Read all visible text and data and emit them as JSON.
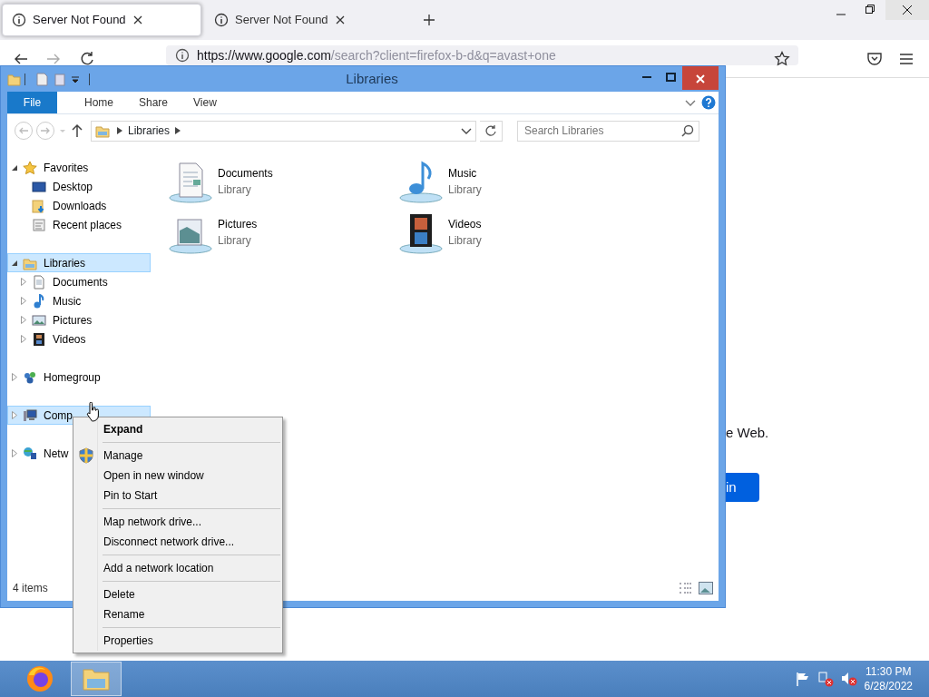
{
  "browser": {
    "tabs": [
      {
        "title": "Server Not Found",
        "selected": true
      },
      {
        "title": "Server Not Found",
        "selected": false
      }
    ],
    "url_host": "https://www.google.com",
    "url_path": "/search?client=firefox-b-d&q=avast+one",
    "page_text": "e Web.",
    "page_button": "in"
  },
  "explorer": {
    "title": "Libraries",
    "ribbon_tabs": [
      {
        "label": "File",
        "selected": true
      },
      {
        "label": "Home",
        "selected": false
      },
      {
        "label": "Share",
        "selected": false
      },
      {
        "label": "View",
        "selected": false
      }
    ],
    "breadcrumb": "Libraries",
    "search": {
      "placeholder": "Search Libraries"
    },
    "nav": [
      {
        "label": "Favorites",
        "kind": "star",
        "expanded": true,
        "selected": false,
        "children": [
          {
            "label": "Desktop",
            "kind": "desktop",
            "selected": false
          },
          {
            "label": "Downloads",
            "kind": "downloads",
            "selected": false
          },
          {
            "label": "Recent places",
            "kind": "recent",
            "selected": false
          }
        ]
      },
      {
        "label": "Libraries",
        "kind": "library",
        "expanded": true,
        "selected": true,
        "children": [
          {
            "label": "Documents",
            "kind": "documents",
            "expanded": false,
            "selected": false
          },
          {
            "label": "Music",
            "kind": "music",
            "expanded": false,
            "selected": false
          },
          {
            "label": "Pictures",
            "kind": "pictures",
            "expanded": false,
            "selected": false
          },
          {
            "label": "Videos",
            "kind": "videos",
            "expanded": false,
            "selected": false
          }
        ]
      },
      {
        "label": "Homegroup",
        "kind": "homegroup",
        "expanded": false,
        "selected": false
      },
      {
        "label": "Comp",
        "kind": "computer",
        "expanded": false,
        "selected": true
      },
      {
        "label": "Netw",
        "kind": "network",
        "expanded": false,
        "selected": false
      }
    ],
    "items": [
      {
        "name": "Documents",
        "type": "Library",
        "kind": "documents"
      },
      {
        "name": "Music",
        "type": "Library",
        "kind": "music"
      },
      {
        "name": "Pictures",
        "type": "Library",
        "kind": "pictures"
      },
      {
        "name": "Videos",
        "type": "Library",
        "kind": "videos"
      }
    ],
    "status": "4 items"
  },
  "context_menu": {
    "groups": [
      [
        {
          "label": "Expand",
          "default": true
        }
      ],
      [
        {
          "label": "Manage",
          "shield": true
        },
        {
          "label": "Open in new window"
        },
        {
          "label": "Pin to Start"
        }
      ],
      [
        {
          "label": "Map network drive..."
        },
        {
          "label": "Disconnect network drive..."
        }
      ],
      [
        {
          "label": "Add a network location"
        }
      ],
      [
        {
          "label": "Delete"
        },
        {
          "label": "Rename"
        }
      ],
      [
        {
          "label": "Properties"
        }
      ]
    ]
  },
  "taskbar": {
    "apps": [
      {
        "kind": "firefox",
        "active": false
      },
      {
        "kind": "explorer",
        "active": true
      }
    ],
    "time": "11:30 PM",
    "date": "6/28/2022"
  }
}
